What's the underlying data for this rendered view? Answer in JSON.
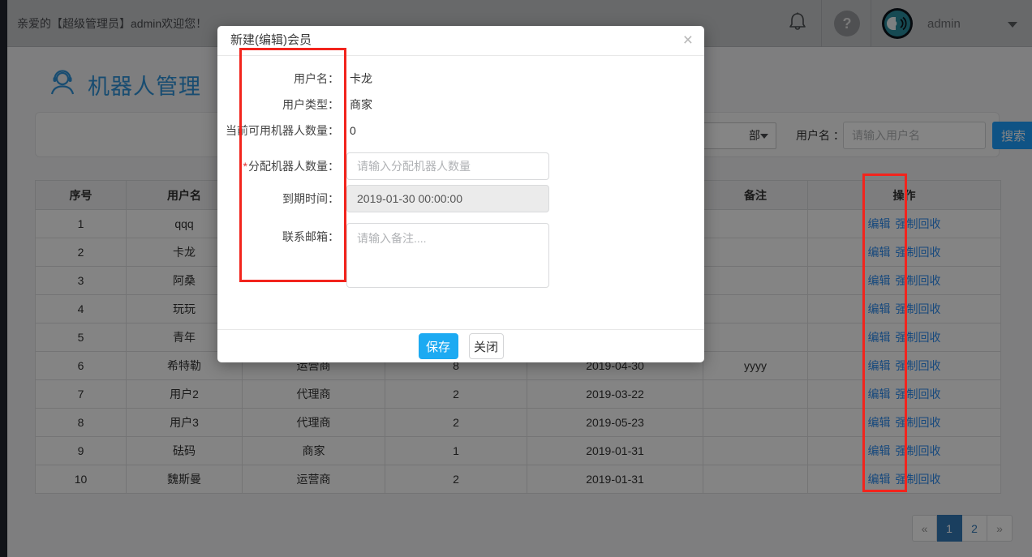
{
  "topbar": {
    "welcome": "亲爱的【超级管理员】admin欢迎您！",
    "help_glyph": "?",
    "username": "admin"
  },
  "page": {
    "title": "机器人管理"
  },
  "filter": {
    "select_visible_text": "部",
    "username_label": "用户名 ：",
    "username_placeholder": "请输入用户名",
    "search_label": "搜索"
  },
  "table": {
    "headers": [
      "序号",
      "用户名",
      "",
      "",
      "",
      "备注",
      "操作"
    ],
    "action_labels": [
      "编辑",
      "强制回收"
    ],
    "rows": [
      {
        "no": "1",
        "name": "qqq",
        "type": "",
        "count": "",
        "expire": "",
        "remark": ""
      },
      {
        "no": "2",
        "name": "卡龙",
        "type": "",
        "count": "",
        "expire": "",
        "remark": ""
      },
      {
        "no": "3",
        "name": "阿桑",
        "type": "",
        "count": "",
        "expire": "",
        "remark": ""
      },
      {
        "no": "4",
        "name": "玩玩",
        "type": "",
        "count": "",
        "expire": "",
        "remark": ""
      },
      {
        "no": "5",
        "name": "青年",
        "type": "",
        "count": "",
        "expire": "",
        "remark": ""
      },
      {
        "no": "6",
        "name": "希特勒",
        "type": "运营商",
        "count": "8",
        "expire": "2019-04-30",
        "remark": "yyyy"
      },
      {
        "no": "7",
        "name": "用户2",
        "type": "代理商",
        "count": "2",
        "expire": "2019-03-22",
        "remark": ""
      },
      {
        "no": "8",
        "name": "用户3",
        "type": "代理商",
        "count": "2",
        "expire": "2019-05-23",
        "remark": ""
      },
      {
        "no": "9",
        "name": "砝码",
        "type": "商家",
        "count": "1",
        "expire": "2019-01-31",
        "remark": ""
      },
      {
        "no": "10",
        "name": "魏斯曼",
        "type": "运营商",
        "count": "2",
        "expire": "2019-01-31",
        "remark": ""
      }
    ]
  },
  "pagination": {
    "prev": "«",
    "pages": [
      {
        "label": "1",
        "active": true
      },
      {
        "label": "2",
        "active": false
      }
    ],
    "next": "»"
  },
  "modal": {
    "title": "新建(编辑)会员",
    "close_glyph": "×",
    "fields": [
      {
        "label": "用户名：",
        "required": false,
        "kind": "static",
        "value": "卡龙"
      },
      {
        "label": "用户类型：",
        "required": false,
        "kind": "static",
        "value": "商家"
      },
      {
        "label": "当前可用机器人数量：",
        "required": false,
        "kind": "static",
        "value": "0"
      },
      {
        "label": "分配机器人数量：",
        "required": true,
        "kind": "input",
        "placeholder": "请输入分配机器人数量"
      },
      {
        "label": "到期时间：",
        "required": false,
        "kind": "disabled",
        "value": "2019-01-30 00:00:00"
      },
      {
        "label": "联系邮箱：",
        "required": false,
        "kind": "textarea",
        "placeholder": "请输入备注...."
      }
    ],
    "save_label": "保存",
    "close_label": "关闭"
  },
  "colors": {
    "accent_blue": "#1e9fff",
    "save_button": "#1caaf2",
    "link_blue": "#2d8cf0",
    "pagination_active": "#337ab7",
    "annotation_red": "#f2241d",
    "topbar_bg": "#c7c9cc",
    "sidebar_strip": "#22262e",
    "avatar_teal": "#2b8f9f"
  }
}
